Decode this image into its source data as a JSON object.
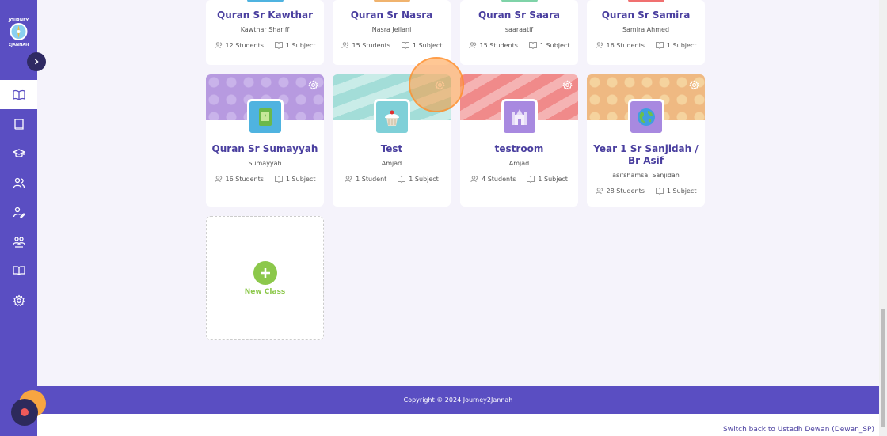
{
  "sidebar": {
    "logo_alt": "Journey 2 Jannah",
    "collapse_icon": "chevron-right-icon",
    "items": [
      {
        "icon": "book-open-icon",
        "active": true
      },
      {
        "icon": "book-icon",
        "active": false
      },
      {
        "icon": "graduation-cap-icon",
        "active": false
      },
      {
        "icon": "users-icon",
        "active": false
      },
      {
        "icon": "user-edit-icon",
        "active": false
      },
      {
        "icon": "group-icon",
        "active": false
      },
      {
        "icon": "open-book-icon",
        "active": false
      },
      {
        "icon": "settings-icon",
        "active": false
      }
    ]
  },
  "top_classes": [
    {
      "title": "Quran Sr Kawthar",
      "owner": "Kawthar Shariff",
      "students": "12 Students",
      "subjects": "1 Subject",
      "accent": "#4fb3e0"
    },
    {
      "title": "Quran Sr Nasra",
      "owner": "Nasra Jeilani",
      "students": "15 Students",
      "subjects": "1 Subject",
      "accent": "#f0b36e"
    },
    {
      "title": "Quran Sr Saara",
      "owner": "saaraatif",
      "students": "15 Students",
      "subjects": "1 Subject",
      "accent": "#7fd3a8"
    },
    {
      "title": "Quran Sr Samira",
      "owner": "Samira Ahmed",
      "students": "16 Students",
      "subjects": "1 Subject",
      "accent": "#f07070"
    }
  ],
  "classes": [
    {
      "title": "Quran Sr Sumayyah",
      "owner": "Sumayyah",
      "students": "16 Students",
      "subjects": "1 Subject",
      "banner_color": "#b79ae0",
      "thumb_color": "#4fb3e0",
      "thumb_icon": "quran-icon"
    },
    {
      "title": "Test",
      "owner": "Amjad",
      "students": "1 Student",
      "subjects": "1 Subject",
      "banner_color": "#a3ddd8",
      "thumb_color": "#7fd0d8",
      "thumb_icon": "cupcake-icon"
    },
    {
      "title": "testroom",
      "owner": "Amjad",
      "students": "4 Students",
      "subjects": "1 Subject",
      "banner_color": "#f08a8a",
      "thumb_color": "#a889e0",
      "thumb_icon": "castle-icon"
    },
    {
      "title": "Year 1 Sr Sanjidah / Br Asif",
      "owner": "asifshamsa, Sanjidah",
      "students": "28 Students",
      "subjects": "1 Subject",
      "banner_color": "#efb982",
      "thumb_color": "#a889e0",
      "thumb_icon": "globe-icon"
    }
  ],
  "new_class": {
    "label": "New Class"
  },
  "footer": {
    "copyright": "Copyright © 2024  Journey2Jannah"
  },
  "switch_back": "Switch back to Ustadh Dewan (Dewan_SP)"
}
